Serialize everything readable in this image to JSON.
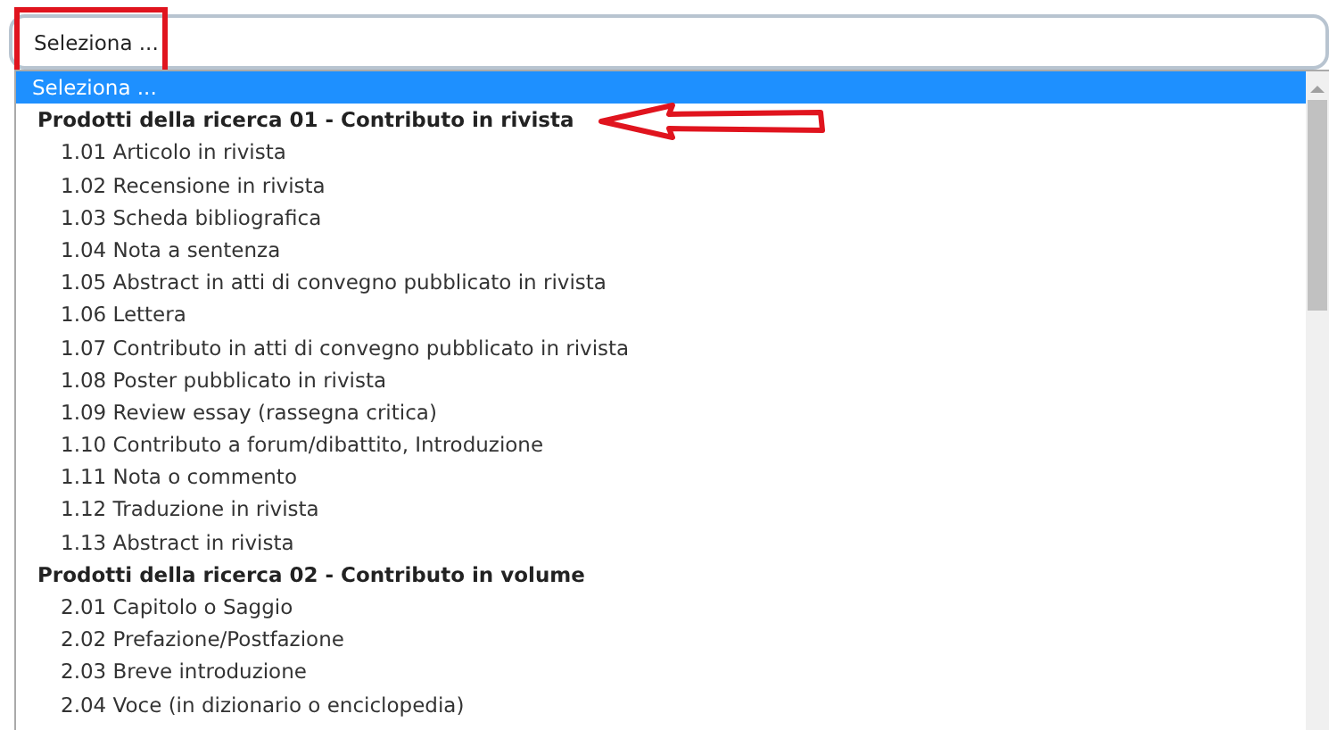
{
  "select": {
    "value": "Seleziona ..."
  },
  "list": {
    "items": [
      {
        "kind": "option",
        "label": "Seleziona ...",
        "selected": true
      },
      {
        "kind": "group",
        "label": "Prodotti della ricerca 01 - Contributo in rivista"
      },
      {
        "kind": "option",
        "label": "1.01 Articolo in rivista",
        "selected": false
      },
      {
        "kind": "option",
        "label": "1.02 Recensione in rivista",
        "selected": false
      },
      {
        "kind": "option",
        "label": "1.03 Scheda bibliografica",
        "selected": false
      },
      {
        "kind": "option",
        "label": "1.04 Nota a sentenza",
        "selected": false
      },
      {
        "kind": "option",
        "label": "1.05 Abstract in atti di convegno pubblicato in rivista",
        "selected": false
      },
      {
        "kind": "option",
        "label": "1.06 Lettera",
        "selected": false
      },
      {
        "kind": "option",
        "label": "1.07 Contributo in atti di convegno pubblicato in rivista",
        "selected": false
      },
      {
        "kind": "option",
        "label": "1.08 Poster pubblicato in rivista",
        "selected": false
      },
      {
        "kind": "option",
        "label": "1.09 Review essay (rassegna critica)",
        "selected": false
      },
      {
        "kind": "option",
        "label": "1.10 Contributo a forum/dibattito, Introduzione",
        "selected": false
      },
      {
        "kind": "option",
        "label": "1.11 Nota o commento",
        "selected": false
      },
      {
        "kind": "option",
        "label": "1.12 Traduzione in rivista",
        "selected": false
      },
      {
        "kind": "option",
        "label": "1.13 Abstract in rivista",
        "selected": false
      },
      {
        "kind": "group",
        "label": "Prodotti della ricerca 02 - Contributo in volume"
      },
      {
        "kind": "option",
        "label": "2.01 Capitolo o Saggio",
        "selected": false
      },
      {
        "kind": "option",
        "label": "2.02 Prefazione/Postfazione",
        "selected": false
      },
      {
        "kind": "option",
        "label": "2.03 Breve introduzione",
        "selected": false
      },
      {
        "kind": "option",
        "label": "2.04 Voce (in dizionario o enciclopedia)",
        "selected": false
      }
    ]
  }
}
